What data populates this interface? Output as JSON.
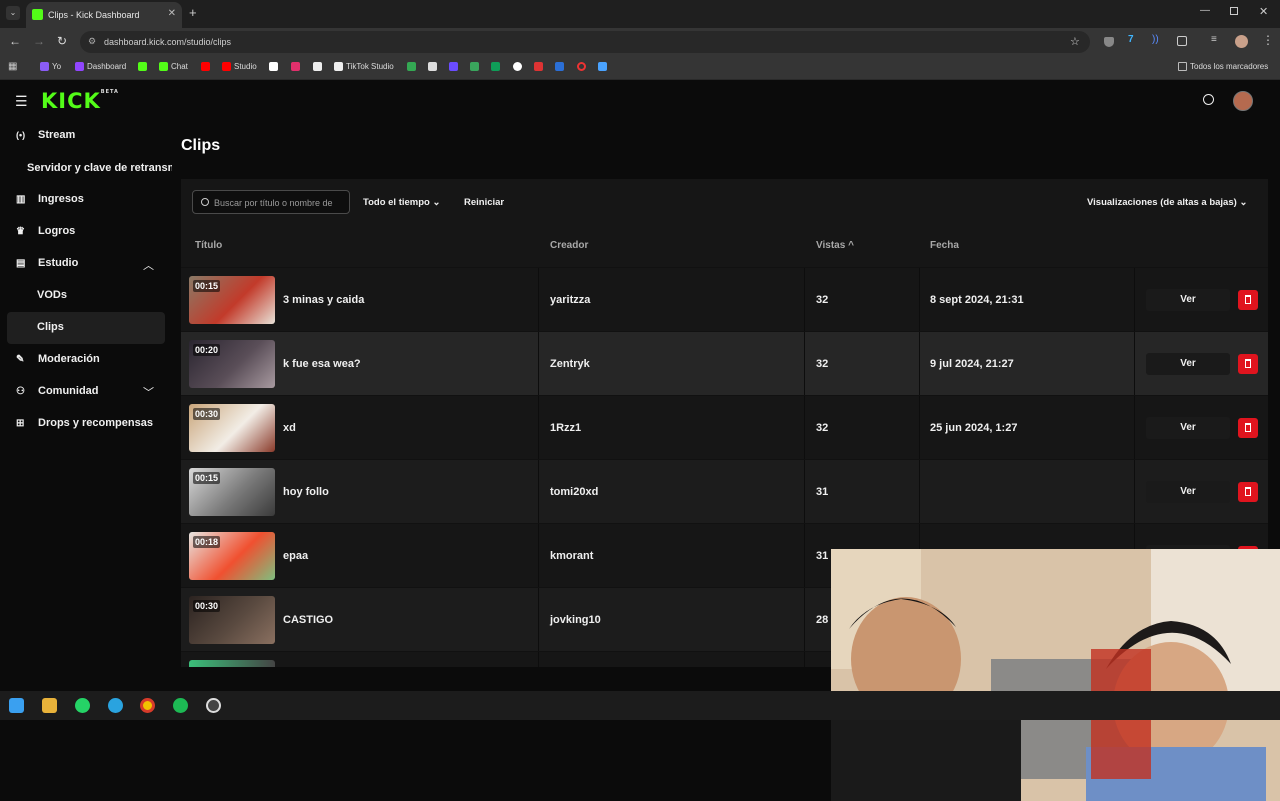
{
  "browser": {
    "tab_title": "Clips - Kick Dashboard",
    "url": "dashboard.kick.com/studio/clips",
    "bookmarks": [
      {
        "label": "Yo",
        "color": "#8a5cf6"
      },
      {
        "label": "Dashboard",
        "color": "#9146ff"
      },
      {
        "label": "",
        "color": "#53fc18"
      },
      {
        "label": "Chat",
        "color": "#53fc18"
      },
      {
        "label": "",
        "color": "#ff0000"
      },
      {
        "label": "Studio",
        "color": "#ff0000"
      },
      {
        "label": "",
        "color": "#ffffff"
      },
      {
        "label": "",
        "color": "#e1306c"
      },
      {
        "label": "",
        "color": "#ffffff"
      },
      {
        "label": "TikTok Studio",
        "color": "#ffffff"
      }
    ],
    "all_bookmarks_label": "Todos los marcadores"
  },
  "app": {
    "logo": "KICK",
    "logo_badge": "BETA",
    "sidebar": [
      {
        "label": "Stream",
        "icon": "broadcast-icon"
      },
      {
        "label": "Servidor y clave de retransmisión",
        "icon": ""
      },
      {
        "label": "Ingresos",
        "icon": "chart-icon"
      },
      {
        "label": "Logros",
        "icon": "trophy-icon"
      },
      {
        "label": "Estudio",
        "icon": "studio-icon"
      },
      {
        "label": "VODs",
        "icon": ""
      },
      {
        "label": "Clips",
        "icon": ""
      },
      {
        "label": "Moderación",
        "icon": "wrench-icon"
      },
      {
        "label": "Comunidad",
        "icon": "people-icon"
      },
      {
        "label": "Drops y recompensas",
        "icon": "gift-icon"
      }
    ],
    "page_title": "Clips",
    "search_placeholder": "Buscar por título o nombre de",
    "filter_time": "Todo el tiempo",
    "reset_label": "Reiniciar",
    "sort_label": "Visualizaciones (de altas a bajas)",
    "columns": {
      "title": "Título",
      "creator": "Creador",
      "views": "Vistas",
      "date": "Fecha"
    },
    "ver_label": "Ver",
    "rows": [
      {
        "duration": "00:15",
        "title": "3 minas y caida",
        "creator": "yaritzza",
        "views": "32",
        "date": "8 sept 2024, 21:31"
      },
      {
        "duration": "00:20",
        "title": "k fue esa wea?",
        "creator": "Zentryk",
        "views": "32",
        "date": "9 jul 2024, 21:27"
      },
      {
        "duration": "00:30",
        "title": "xd",
        "creator": "1Rzz1",
        "views": "32",
        "date": "25 jun 2024, 1:27"
      },
      {
        "duration": "00:15",
        "title": "hoy follo",
        "creator": "tomi20xd",
        "views": "31",
        "date": ""
      },
      {
        "duration": "00:18",
        "title": "epaa",
        "creator": "kmorant",
        "views": "31",
        "date": ""
      },
      {
        "duration": "00:30",
        "title": "CASTIGO",
        "creator": "jovking10",
        "views": "28",
        "date": ""
      }
    ]
  },
  "colors": {
    "brand": "#53fc18",
    "delete": "#e0141e"
  }
}
